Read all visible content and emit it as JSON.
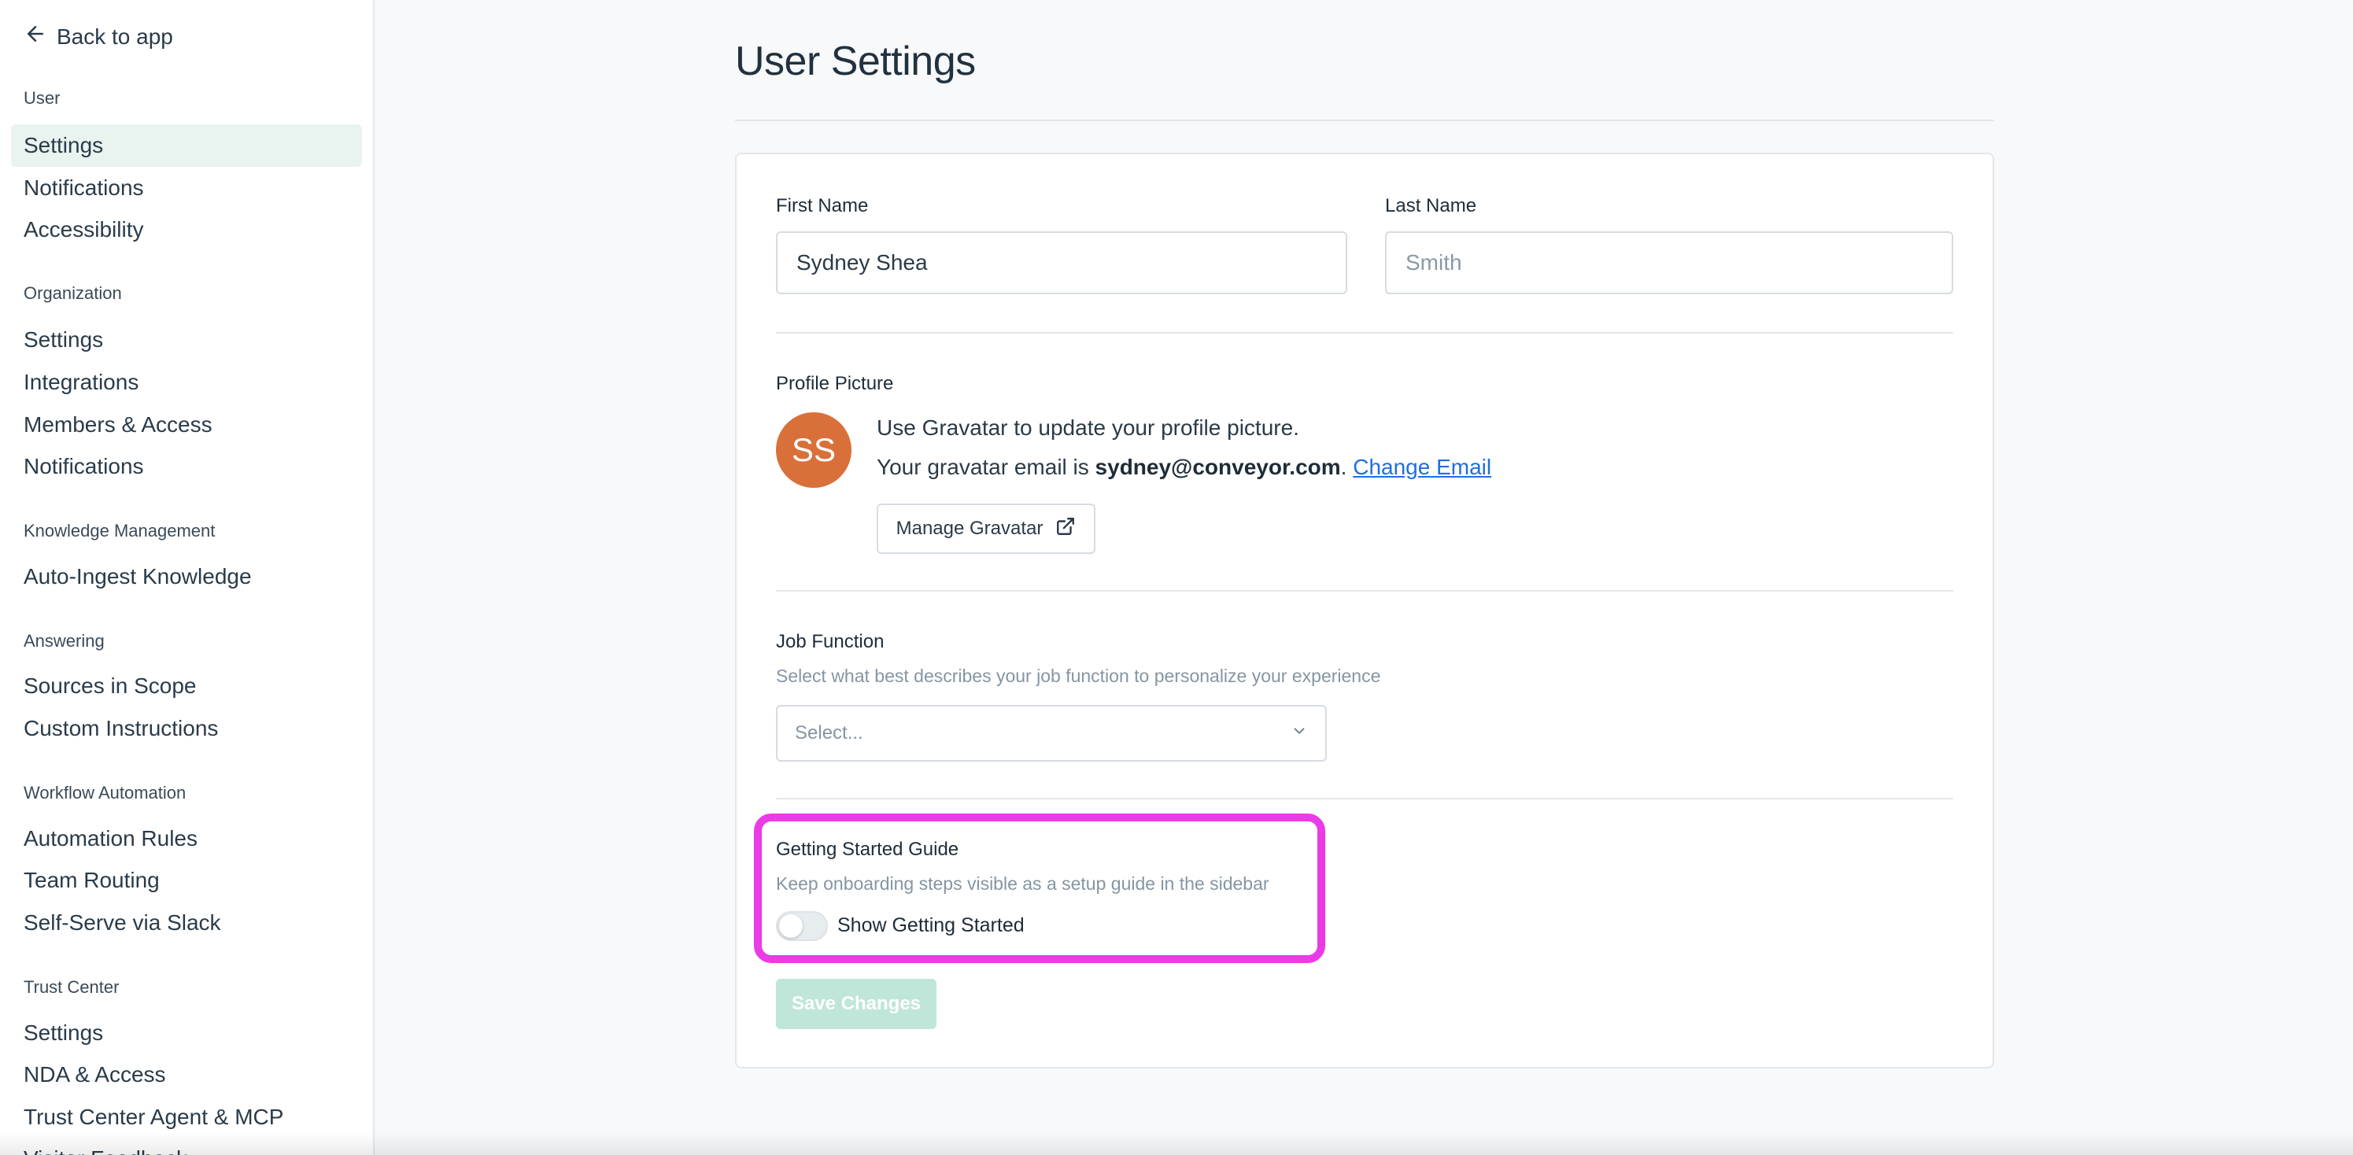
{
  "sidebar": {
    "back_label": "Back to app",
    "groups": [
      {
        "title": "User",
        "items": [
          {
            "label": "Settings"
          },
          {
            "label": "Notifications"
          },
          {
            "label": "Accessibility"
          }
        ]
      },
      {
        "title": "Organization",
        "items": [
          {
            "label": "Settings"
          },
          {
            "label": "Integrations"
          },
          {
            "label": "Members & Access"
          },
          {
            "label": "Notifications"
          }
        ]
      },
      {
        "title": "Knowledge Management",
        "items": [
          {
            "label": "Auto-Ingest Knowledge"
          }
        ]
      },
      {
        "title": "Answering",
        "items": [
          {
            "label": "Sources in Scope"
          },
          {
            "label": "Custom Instructions"
          }
        ]
      },
      {
        "title": "Workflow Automation",
        "items": [
          {
            "label": "Automation Rules"
          },
          {
            "label": "Team Routing"
          },
          {
            "label": "Self-Serve via Slack"
          }
        ]
      },
      {
        "title": "Trust Center",
        "items": [
          {
            "label": "Settings"
          },
          {
            "label": "NDA & Access"
          },
          {
            "label": "Trust Center Agent & MCP"
          },
          {
            "label": "Visitor Feedback"
          }
        ]
      }
    ],
    "active_item": "User > Settings"
  },
  "page": {
    "title": "User Settings"
  },
  "form": {
    "first_name": {
      "label": "First Name",
      "value": "Sydney Shea",
      "placeholder": ""
    },
    "last_name": {
      "label": "Last Name",
      "value": "",
      "placeholder": "Smith"
    },
    "profile_picture": {
      "label": "Profile Picture",
      "initials": "SS",
      "line1": "Use Gravatar to update your profile picture.",
      "line2_prefix": "Your gravatar email is ",
      "email": "sydney@conveyor.com",
      "line2_suffix": ".",
      "change_email_link": "Change Email",
      "manage_button": "Manage Gravatar",
      "avatar_color": "#d9703a"
    },
    "job_function": {
      "label": "Job Function",
      "help": "Select what best describes your job function to personalize your experience",
      "placeholder": "Select..."
    },
    "getting_started": {
      "label": "Getting Started Guide",
      "help": "Keep onboarding steps visible as a setup guide in the sidebar",
      "toggle_label": "Show Getting Started",
      "enabled": false,
      "highlight_color": "#ea3be6"
    },
    "save_button": "Save Changes",
    "save_enabled": false,
    "save_color": "#bfe6d9"
  }
}
